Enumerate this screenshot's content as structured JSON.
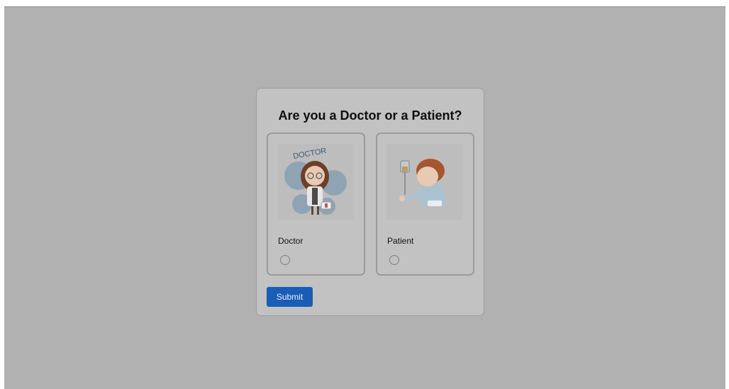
{
  "dialog": {
    "title": "Are you a Doctor or a Patient?",
    "options": [
      {
        "label": "Doctor",
        "image_text": "DOCTOR",
        "selected": false
      },
      {
        "label": "Patient",
        "selected": false
      }
    ],
    "submit_label": "Submit"
  },
  "colors": {
    "overlay": "#b1b1b1",
    "dialog_background": "#c2c2c2",
    "submit_button": "#1a5db7"
  }
}
